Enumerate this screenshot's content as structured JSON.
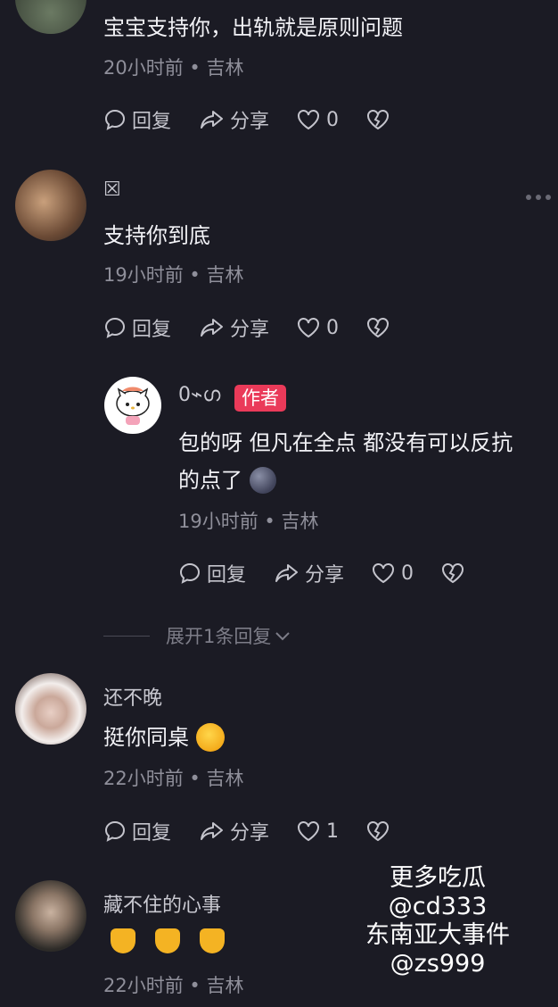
{
  "comments": [
    {
      "text": "宝宝支持你，出轨就是原则问题",
      "time": "20小时前",
      "location": "吉林",
      "reply_label": "回复",
      "share_label": "分享",
      "likes": "0"
    },
    {
      "username": "☒",
      "text": "支持你到底",
      "time": "19小时前",
      "location": "吉林",
      "reply_label": "回复",
      "share_label": "分享",
      "likes": "0"
    },
    {
      "username": "0⌁ഗ",
      "badge": "作者",
      "text_line1": "包的呀 但凡在全点 都没有可以反抗",
      "text_line2": "的点了",
      "time": "19小时前",
      "location": "吉林",
      "reply_label": "回复",
      "share_label": "分享",
      "likes": "0"
    },
    {
      "username": "还不晚",
      "text": "挺你同桌",
      "time": "22小时前",
      "location": "吉林",
      "reply_label": "回复",
      "share_label": "分享",
      "likes": "1"
    },
    {
      "username": "藏不住的心事",
      "time": "22小时前",
      "location": "吉林"
    }
  ],
  "expand_replies": "展开1条回复",
  "separator": "•",
  "watermark": {
    "line1": "更多吃瓜",
    "line2": "@cd333",
    "line3": "东南亚大事件",
    "line4": "@zs999"
  },
  "colors": {
    "background": "#1b1b24",
    "author_badge": "#ea3a59"
  }
}
